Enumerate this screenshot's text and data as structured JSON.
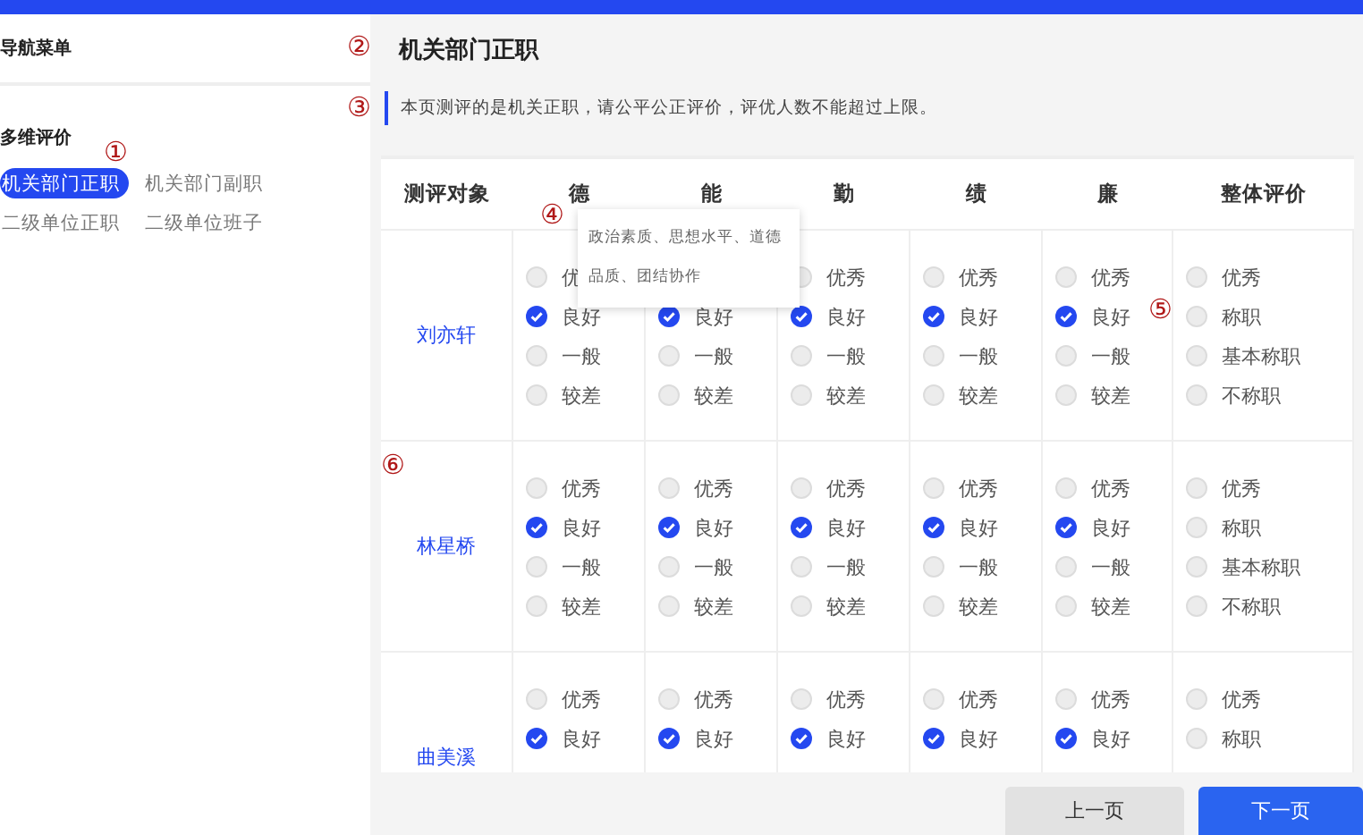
{
  "sidebar": {
    "title": "导航菜单",
    "section": "多维评价",
    "items": [
      {
        "label": "机关部门正职",
        "selected": true
      },
      {
        "label": "机关部门副职",
        "selected": false
      },
      {
        "label": "二级单位正职",
        "selected": false
      },
      {
        "label": "二级单位班子",
        "selected": false
      }
    ]
  },
  "page": {
    "title": "机关部门正职",
    "notice": "本页测评的是机关正职，请公平公正评价，评优人数不能超过上限。"
  },
  "table": {
    "columns": [
      "测评对象",
      "德",
      "能",
      "勤",
      "绩",
      "廉",
      "整体评价"
    ],
    "tooltip": "政治素质、思想水平、道德品质、团结协作",
    "rows": [
      {
        "cells": [
          {
            "kind": "name",
            "text": "刘亦轩"
          },
          {
            "kind": "options",
            "options": [
              {
                "label": "优",
                "selected": false
              },
              {
                "label": "良好",
                "selected": true
              },
              {
                "label": "一般",
                "selected": false
              },
              {
                "label": "较差",
                "selected": false
              }
            ]
          },
          {
            "kind": "options",
            "first_covered": true,
            "options": [
              {
                "label": "良好",
                "selected": true
              },
              {
                "label": "一般",
                "selected": false
              },
              {
                "label": "较差",
                "selected": false
              }
            ]
          },
          {
            "kind": "options",
            "options": [
              {
                "label": "优秀",
                "selected": false
              },
              {
                "label": "良好",
                "selected": true
              },
              {
                "label": "一般",
                "selected": false
              },
              {
                "label": "较差",
                "selected": false
              }
            ]
          },
          {
            "kind": "options",
            "options": [
              {
                "label": "优秀",
                "selected": false
              },
              {
                "label": "良好",
                "selected": true
              },
              {
                "label": "一般",
                "selected": false
              },
              {
                "label": "较差",
                "selected": false
              }
            ]
          },
          {
            "kind": "options",
            "options": [
              {
                "label": "优秀",
                "selected": false
              },
              {
                "label": "良好",
                "selected": true
              },
              {
                "label": "一般",
                "selected": false
              },
              {
                "label": "较差",
                "selected": false
              }
            ]
          },
          {
            "kind": "options",
            "options": [
              {
                "label": "优秀",
                "selected": false
              },
              {
                "label": "称职",
                "selected": false
              },
              {
                "label": "基本称职",
                "selected": false
              },
              {
                "label": "不称职",
                "selected": false
              }
            ]
          }
        ]
      },
      {
        "cells": [
          {
            "kind": "name",
            "text": "林星桥"
          },
          {
            "kind": "options",
            "options": [
              {
                "label": "优秀",
                "selected": false
              },
              {
                "label": "良好",
                "selected": true
              },
              {
                "label": "一般",
                "selected": false
              },
              {
                "label": "较差",
                "selected": false
              }
            ]
          },
          {
            "kind": "options",
            "options": [
              {
                "label": "优秀",
                "selected": false
              },
              {
                "label": "良好",
                "selected": true
              },
              {
                "label": "一般",
                "selected": false
              },
              {
                "label": "较差",
                "selected": false
              }
            ]
          },
          {
            "kind": "options",
            "options": [
              {
                "label": "优秀",
                "selected": false
              },
              {
                "label": "良好",
                "selected": true
              },
              {
                "label": "一般",
                "selected": false
              },
              {
                "label": "较差",
                "selected": false
              }
            ]
          },
          {
            "kind": "options",
            "options": [
              {
                "label": "优秀",
                "selected": false
              },
              {
                "label": "良好",
                "selected": true
              },
              {
                "label": "一般",
                "selected": false
              },
              {
                "label": "较差",
                "selected": false
              }
            ]
          },
          {
            "kind": "options",
            "options": [
              {
                "label": "优秀",
                "selected": false
              },
              {
                "label": "良好",
                "selected": true
              },
              {
                "label": "一般",
                "selected": false
              },
              {
                "label": "较差",
                "selected": false
              }
            ]
          },
          {
            "kind": "options",
            "options": [
              {
                "label": "优秀",
                "selected": false
              },
              {
                "label": "称职",
                "selected": false
              },
              {
                "label": "基本称职",
                "selected": false
              },
              {
                "label": "不称职",
                "selected": false
              }
            ]
          }
        ]
      },
      {
        "cells": [
          {
            "kind": "name",
            "text": "曲美溪"
          },
          {
            "kind": "options",
            "options": [
              {
                "label": "优秀",
                "selected": false
              },
              {
                "label": "良好",
                "selected": true
              }
            ]
          },
          {
            "kind": "options",
            "options": [
              {
                "label": "优秀",
                "selected": false
              },
              {
                "label": "良好",
                "selected": true
              }
            ]
          },
          {
            "kind": "options",
            "options": [
              {
                "label": "优秀",
                "selected": false
              },
              {
                "label": "良好",
                "selected": true
              }
            ]
          },
          {
            "kind": "options",
            "options": [
              {
                "label": "优秀",
                "selected": false
              },
              {
                "label": "良好",
                "selected": true
              }
            ]
          },
          {
            "kind": "options",
            "options": [
              {
                "label": "优秀",
                "selected": false
              },
              {
                "label": "良好",
                "selected": true
              }
            ]
          },
          {
            "kind": "options",
            "options": [
              {
                "label": "优秀",
                "selected": false
              },
              {
                "label": "称职",
                "selected": false
              }
            ]
          }
        ]
      }
    ]
  },
  "buttons": [
    {
      "label": "上一页",
      "kind": "secondary"
    },
    {
      "label": "下一页",
      "kind": "primary"
    }
  ],
  "annotations": [
    "①",
    "②",
    "③",
    "④",
    "⑤",
    "⑥"
  ]
}
